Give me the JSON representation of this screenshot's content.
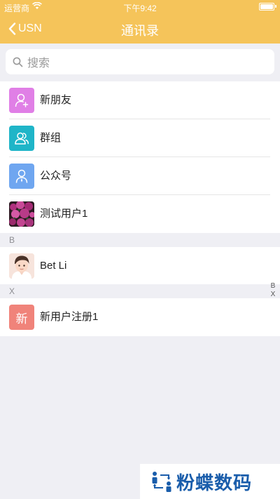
{
  "status_bar": {
    "carrier": "运营商",
    "time": "下午9:42"
  },
  "nav": {
    "back_label": "USN",
    "title": "通讯录"
  },
  "search": {
    "placeholder": "搜索"
  },
  "entries": [
    {
      "label": "新朋友",
      "icon": "add-user-icon",
      "color": "#e07fe6"
    },
    {
      "label": "群组",
      "icon": "group-icon",
      "color": "#1fb5c8"
    },
    {
      "label": "公众号",
      "icon": "official-account-icon",
      "color": "#6fa6f0"
    },
    {
      "label": "测试用户1",
      "icon": "flower-photo-avatar"
    }
  ],
  "sections": [
    {
      "letter": "B",
      "contacts": [
        {
          "name": "Bet Li"
        }
      ]
    },
    {
      "letter": "X",
      "contacts": [
        {
          "name": "新用户注册1",
          "avatar_text": "新",
          "color": "#f0837a"
        }
      ]
    }
  ],
  "index_bar": [
    "B",
    "X"
  ],
  "watermark": {
    "text": "粉蝶数码"
  }
}
